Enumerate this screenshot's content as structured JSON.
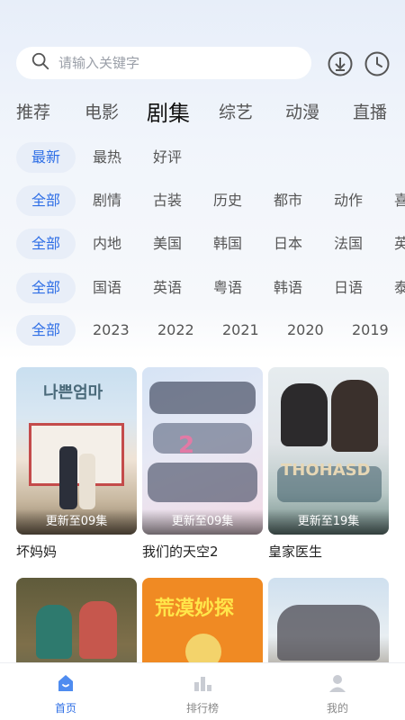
{
  "search": {
    "placeholder": "请输入关键字"
  },
  "tabs": [
    {
      "label": "推荐"
    },
    {
      "label": "电影"
    },
    {
      "label": "剧集"
    },
    {
      "label": "综艺"
    },
    {
      "label": "动漫"
    },
    {
      "label": "直播"
    }
  ],
  "filters": {
    "sort": [
      {
        "label": "最新"
      },
      {
        "label": "最热"
      },
      {
        "label": "好评"
      }
    ],
    "genre": [
      {
        "label": "全部"
      },
      {
        "label": "剧情"
      },
      {
        "label": "古装"
      },
      {
        "label": "历史"
      },
      {
        "label": "都市"
      },
      {
        "label": "动作"
      },
      {
        "label": "喜"
      }
    ],
    "region": [
      {
        "label": "全部"
      },
      {
        "label": "内地"
      },
      {
        "label": "美国"
      },
      {
        "label": "韩国"
      },
      {
        "label": "日本"
      },
      {
        "label": "法国"
      },
      {
        "label": "英"
      }
    ],
    "language": [
      {
        "label": "全部"
      },
      {
        "label": "国语"
      },
      {
        "label": "英语"
      },
      {
        "label": "粤语"
      },
      {
        "label": "韩语"
      },
      {
        "label": "日语"
      },
      {
        "label": "泰"
      }
    ],
    "year": [
      {
        "label": "全部"
      },
      {
        "label": "2023"
      },
      {
        "label": "2022"
      },
      {
        "label": "2021"
      },
      {
        "label": "2020"
      },
      {
        "label": "2019"
      }
    ]
  },
  "cards": [
    {
      "title": "坏妈妈",
      "badge": "更新至09集",
      "poster_text": "나쁜엄마"
    },
    {
      "title": "我们的天空2",
      "badge": "更新至09集"
    },
    {
      "title": "皇家医生",
      "badge": "更新至19集"
    },
    {
      "title": "",
      "badge": ""
    },
    {
      "title": "",
      "badge": "",
      "poster_text": "荒漠妙探"
    },
    {
      "title": "",
      "badge": ""
    }
  ],
  "bottom_nav": [
    {
      "label": "首页"
    },
    {
      "label": "排行榜"
    },
    {
      "label": "我的"
    }
  ],
  "colors": {
    "accent": "#2f6fe6"
  }
}
